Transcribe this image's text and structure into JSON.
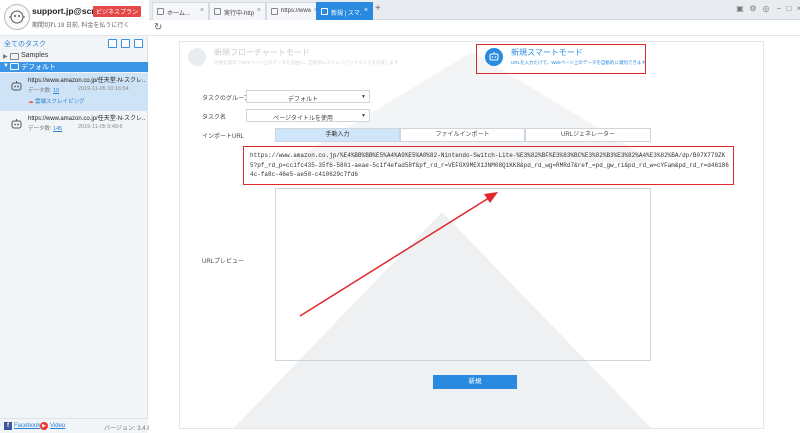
{
  "account": {
    "email": "support.jp@scrap...",
    "plan_badge": "ビジネスプラン",
    "expiry": "期間切れ 19 日前, 料金を払うに行く"
  },
  "sidebar": {
    "tasks_label": "全てのタスク",
    "groups": [
      {
        "name": "Samples"
      },
      {
        "name": "デフォルト"
      }
    ],
    "tasks": [
      {
        "title": "https://www.amazon.co.jp/任天堂-N-スクレ...",
        "count_label": "データ数:",
        "count": "10",
        "date": "2019-11-05 10:16:54",
        "cloud": "雲端スクレイピング"
      },
      {
        "title": "https://www.amazon.co.jp/任天堂-N-スクレ...",
        "count_label": "データ数:",
        "count": "145",
        "date": "2019-11-05 9:49:6"
      }
    ],
    "footer": {
      "facebook": "Facebook",
      "video": "Video",
      "version": "バージョン: 3.4.6"
    }
  },
  "tabs": [
    {
      "label": "ホーム..."
    },
    {
      "label": "実行中-http..."
    },
    {
      "label": "https://www..."
    },
    {
      "label": "新規 | スマ..."
    }
  ],
  "modes": {
    "flow": {
      "title": "新規フローチャートモード",
      "desc": "可視化操作でWebページ上のデータを自由に、自動的にスクレイピングタスクを作成します"
    },
    "smart": {
      "title": "新規スマートモード",
      "desc": "URLを入力だけで、Webページ上のデータを自動的に識別できます"
    }
  },
  "form": {
    "group_label": "タスクのグループ",
    "group_value": "デフォルト",
    "name_label": "タスク名",
    "name_value": "ページタイトルを使用",
    "import_label": "インポートURL",
    "import_tabs": [
      "手動入力",
      "ファイルインポート",
      "URLジェネレーター"
    ],
    "url": "https://www.amazon.co.jp/%E4%BB%BB%E5%A4%A9%E5%A0%82-Nintendo-Switch-Lite-%E3%82%BF%E3%83%BC%E3%82%B3%E3%82%A4%E3%82%BA/dp/B07X779ZK5?pf_rd_p=cc1fc435-35f6-5801-aeae-5c1f4efad58f&pf_rd_r=VEFGX9MEX13NM08Q1KK8&pd_rd_wg=RMRd7&ref_=pd_gw_ri&pd_rd_w=cYFam&pd_rd_r=d461864c-fa8c-46e5-ae50-c410629c7fd6",
    "preview_label": "URLプレビュー",
    "submit": "新規"
  },
  "colors": {
    "accent": "#2a8ae0",
    "highlight": "#e0282b"
  }
}
